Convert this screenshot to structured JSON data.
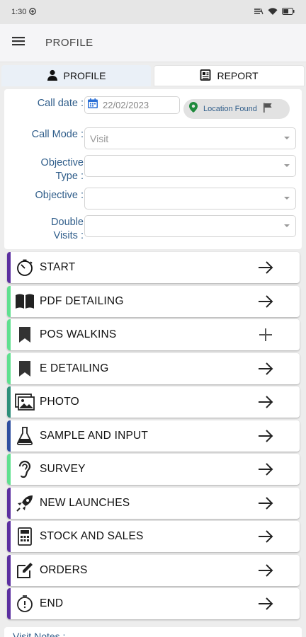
{
  "status_bar": {
    "time": "1:30"
  },
  "app_bar": {
    "title": "PROFILE"
  },
  "tabs": [
    {
      "label": "PROFILE",
      "icon": "person-icon"
    },
    {
      "label": "REPORT",
      "icon": "report-icon"
    }
  ],
  "form": {
    "call_date": {
      "label": "Call date :",
      "value": "22/02/2023"
    },
    "location_status": "Location Found",
    "call_mode": {
      "label": "Call Mode :",
      "value": "Visit"
    },
    "objective_type": {
      "label_line1": "Objective",
      "label_line2": "Type :",
      "value": ""
    },
    "objective": {
      "label": "Objective :",
      "value": ""
    },
    "double_visits": {
      "label_line1": "Double",
      "label_line2": "Visits :",
      "value": ""
    }
  },
  "menu_items": [
    {
      "label": "START",
      "icon": "stopwatch-icon",
      "action": "arrow-right-icon",
      "accent": "#5b2fa0"
    },
    {
      "label": "PDF DETAILING",
      "icon": "book-icon",
      "action": "arrow-right-icon",
      "accent": "#5fe08f"
    },
    {
      "label": "POS WALKINS",
      "icon": "bookmark-icon",
      "action": "plus-icon",
      "accent": "#5fe08f"
    },
    {
      "label": "E DETAILING",
      "icon": "bookmark-icon",
      "action": "arrow-right-icon",
      "accent": "#5fe08f"
    },
    {
      "label": "PHOTO",
      "icon": "photo-icon",
      "action": "arrow-right-icon",
      "accent": "#2f8f7a"
    },
    {
      "label": "SAMPLE AND INPUT",
      "icon": "flask-icon",
      "action": "arrow-right-icon",
      "accent": "#2f4fa0"
    },
    {
      "label": "SURVEY",
      "icon": "ear-icon",
      "action": "arrow-right-icon",
      "accent": "#5fe08f"
    },
    {
      "label": "NEW LAUNCHES",
      "icon": "rocket-icon",
      "action": "arrow-right-icon",
      "accent": "#5b2fa0"
    },
    {
      "label": "STOCK AND SALES",
      "icon": "calculator-icon",
      "action": "arrow-right-icon",
      "accent": "#5b2fa0"
    },
    {
      "label": "ORDERS",
      "icon": "edit-icon",
      "action": "arrow-right-icon",
      "accent": "#5b2fa0"
    },
    {
      "label": "END",
      "icon": "timer-icon",
      "action": "arrow-right-icon",
      "accent": "#5b2fa0"
    }
  ],
  "visit_notes_label": "Visit Notes :",
  "colors": {
    "label_blue": "#2f5d8a",
    "location_pin": "#1e8a3c",
    "calendar_blue": "#2a6fd6"
  }
}
